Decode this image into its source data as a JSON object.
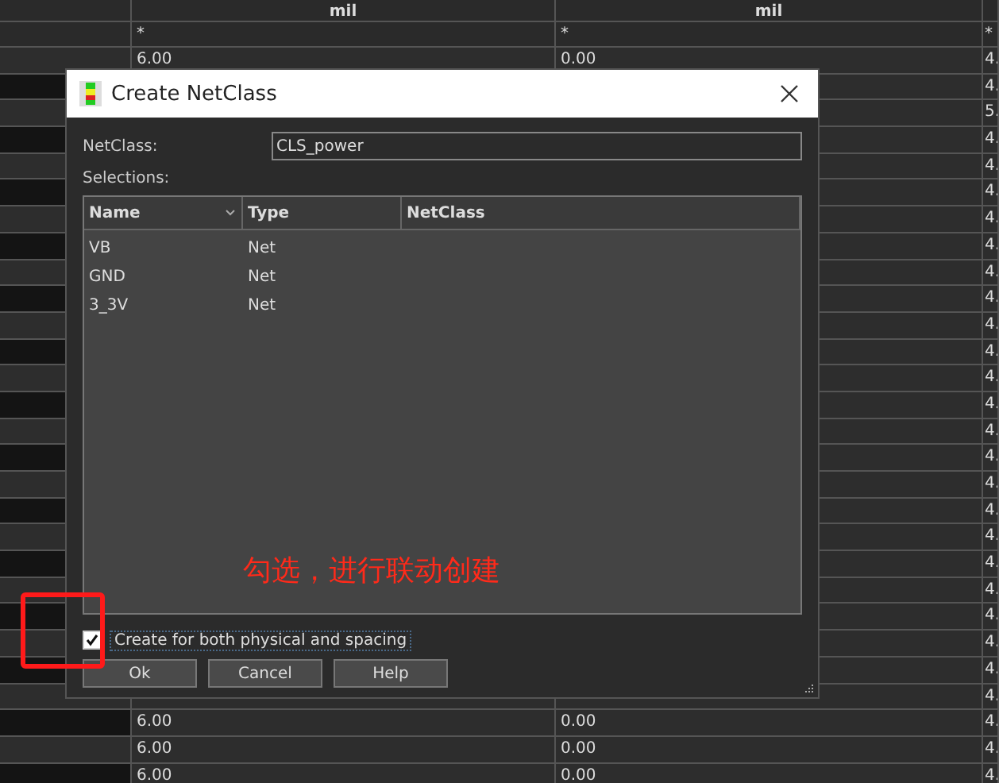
{
  "grid": {
    "header": {
      "column_2": "mil",
      "column_3": "mil"
    },
    "filter_row": {
      "column_2": "*",
      "column_3": "*",
      "column_4": "*"
    },
    "rows": [
      {
        "column_2": "6.00",
        "column_3": "0.00",
        "column_4": "4."
      },
      {
        "column_4": "4."
      },
      {
        "column_4": "5."
      },
      {
        "column_4": "4."
      },
      {
        "column_4": "4."
      },
      {
        "column_4": "4."
      },
      {
        "column_4": "4."
      },
      {
        "column_4": "4."
      },
      {
        "column_4": "4."
      },
      {
        "column_4": "4."
      },
      {
        "column_4": "4."
      },
      {
        "column_4": "4."
      },
      {
        "column_4": "4."
      },
      {
        "column_4": "4."
      },
      {
        "column_4": "4."
      },
      {
        "column_4": "4."
      },
      {
        "column_4": "4."
      },
      {
        "column_4": "4."
      },
      {
        "column_4": "4."
      },
      {
        "column_4": "4."
      },
      {
        "column_4": "4."
      },
      {
        "column_4": "4."
      },
      {
        "column_4": "4."
      },
      {
        "column_4": "4."
      },
      {
        "column_4": "4."
      },
      {
        "column_2": "6.00",
        "column_3": "0.00",
        "column_4": "4."
      },
      {
        "column_2": "6.00",
        "column_3": "0.00",
        "column_4": "4."
      },
      {
        "column_2": "6.00",
        "column_3": "0.00",
        "column_4": "4."
      }
    ]
  },
  "dialog": {
    "title": "Create NetClass",
    "netclass_label": "NetClass:",
    "netclass_value": "CLS_power",
    "selections_label": "Selections:",
    "table": {
      "columns": [
        "Name",
        "Type",
        "NetClass"
      ],
      "rows": [
        {
          "name": "VB",
          "type": "Net"
        },
        {
          "name": "GND",
          "type": "Net"
        },
        {
          "name": "3_3V",
          "type": "Net"
        }
      ]
    },
    "checkbox": {
      "label": "Create  for both physical and spacing",
      "checked": true
    },
    "buttons": [
      "Ok",
      "Cancel",
      "Help"
    ]
  },
  "annotation": {
    "text": "勾选，进行联动创建"
  }
}
